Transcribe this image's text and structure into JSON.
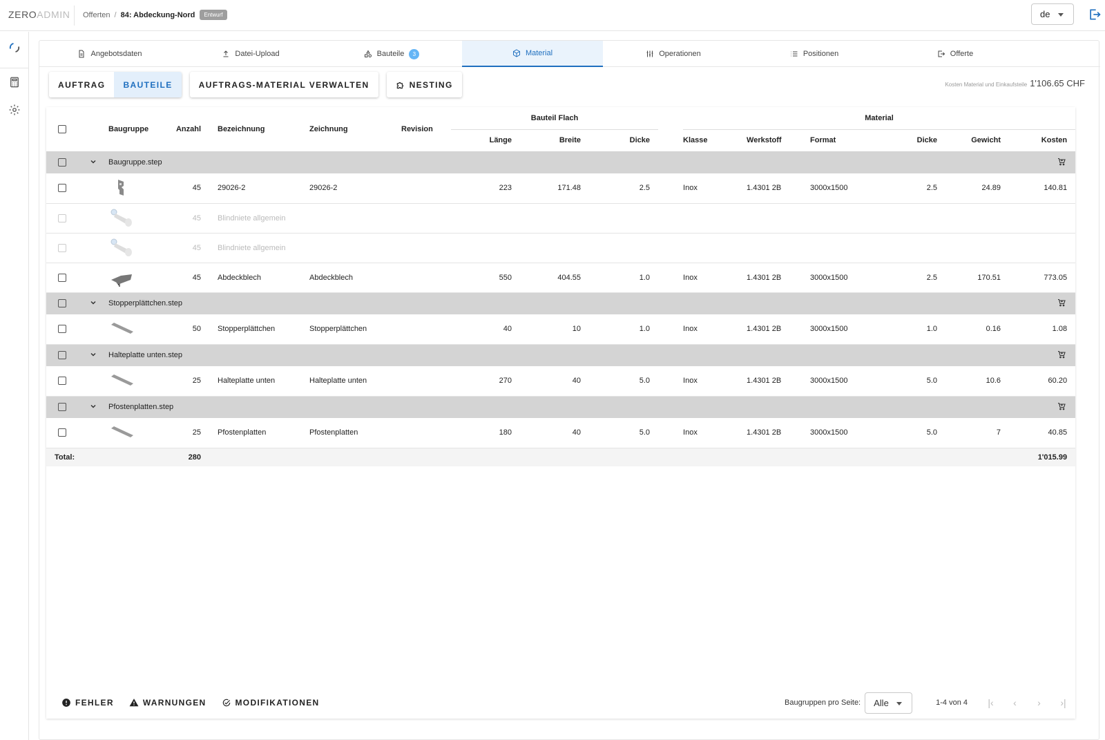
{
  "topbar": {
    "logo_bold": "ZERO",
    "logo_thin": "ADMIN",
    "breadcrumb_parent": "Offerten",
    "breadcrumb_sep": "/",
    "breadcrumb_current": "84: Abdeckung-Nord",
    "status_badge": "Entwurf",
    "language": "de"
  },
  "tabs": [
    {
      "label": "Angebotsdaten",
      "icon": "document-icon"
    },
    {
      "label": "Datei-Upload",
      "icon": "upload-icon"
    },
    {
      "label": "Bauteile",
      "icon": "parts-icon",
      "count": "3"
    },
    {
      "label": "Material",
      "icon": "cube-icon",
      "active": true
    },
    {
      "label": "Operationen",
      "icon": "sliders-icon"
    },
    {
      "label": "Positionen",
      "icon": "list-icon"
    },
    {
      "label": "Offerte",
      "icon": "export-icon"
    }
  ],
  "toolbar": {
    "toggle_auftrag": "AUFTRAG",
    "toggle_bauteile": "BAUTEILE",
    "manage_material": "AUFTRAGS-MATERIAL VERWALTEN",
    "nesting": "NESTING",
    "cost_label": "Kosten Material und Einkaufsteile",
    "cost_value": "1'106.65 CHF"
  },
  "table": {
    "group_headers": {
      "bauteil_flach": "Bauteil Flach",
      "material": "Material"
    },
    "columns": {
      "baugruppe": "Baugruppe",
      "anzahl": "Anzahl",
      "bezeichnung": "Bezeichnung",
      "zeichnung": "Zeichnung",
      "revision": "Revision",
      "laenge": "Länge",
      "breite": "Breite",
      "dicke": "Dicke",
      "klasse": "Klasse",
      "werkstoff": "Werkstoff",
      "format": "Format",
      "mdicke": "Dicke",
      "gewicht": "Gewicht",
      "kosten": "Kosten"
    },
    "groups": [
      {
        "name": "Baugruppe.step",
        "rows": [
          {
            "thumb": "bracket",
            "anzahl": "45",
            "bezeichnung": "29026-2",
            "zeichnung": "29026-2",
            "laenge": "223",
            "breite": "171.48",
            "dicke": "2.5",
            "klasse": "Inox",
            "werkstoff": "1.4301 2B",
            "format": "3000x1500",
            "mdicke": "2.5",
            "gewicht": "24.89",
            "kosten": "140.81"
          },
          {
            "thumb": "rivet",
            "dim": true,
            "anzahl": "45",
            "bezeichnung": "Blindniete allgemein",
            "zeichnung": "",
            "laenge": "",
            "breite": "",
            "dicke": "",
            "klasse": "",
            "werkstoff": "",
            "format": "",
            "mdicke": "",
            "gewicht": "",
            "kosten": ""
          },
          {
            "thumb": "rivet",
            "dim": true,
            "anzahl": "45",
            "bezeichnung": "Blindniete allgemein",
            "zeichnung": "",
            "laenge": "",
            "breite": "",
            "dicke": "",
            "klasse": "",
            "werkstoff": "",
            "format": "",
            "mdicke": "",
            "gewicht": "",
            "kosten": ""
          },
          {
            "thumb": "cover",
            "anzahl": "45",
            "bezeichnung": "Abdeckblech",
            "zeichnung": "Abdeckblech",
            "laenge": "550",
            "breite": "404.55",
            "dicke": "1.0",
            "klasse": "Inox",
            "werkstoff": "1.4301 2B",
            "format": "3000x1500",
            "mdicke": "2.5",
            "gewicht": "170.51",
            "kosten": "773.05"
          }
        ]
      },
      {
        "name": "Stopperplättchen.step",
        "rows": [
          {
            "thumb": "plate",
            "anzahl": "50",
            "bezeichnung": "Stopperplättchen",
            "zeichnung": "Stopperplättchen",
            "laenge": "40",
            "breite": "10",
            "dicke": "1.0",
            "klasse": "Inox",
            "werkstoff": "1.4301 2B",
            "format": "3000x1500",
            "mdicke": "1.0",
            "gewicht": "0.16",
            "kosten": "1.08"
          }
        ]
      },
      {
        "name": "Halteplatte unten.step",
        "rows": [
          {
            "thumb": "plate",
            "anzahl": "25",
            "bezeichnung": "Halteplatte unten",
            "zeichnung": "Halteplatte unten",
            "laenge": "270",
            "breite": "40",
            "dicke": "5.0",
            "klasse": "Inox",
            "werkstoff": "1.4301 2B",
            "format": "3000x1500",
            "mdicke": "5.0",
            "gewicht": "10.6",
            "kosten": "60.20"
          }
        ]
      },
      {
        "name": "Pfostenplatten.step",
        "rows": [
          {
            "thumb": "plate",
            "anzahl": "25",
            "bezeichnung": "Pfostenplatten",
            "zeichnung": "Pfostenplatten",
            "laenge": "180",
            "breite": "40",
            "dicke": "5.0",
            "klasse": "Inox",
            "werkstoff": "1.4301 2B",
            "format": "3000x1500",
            "mdicke": "5.0",
            "gewicht": "7",
            "kosten": "40.85"
          }
        ]
      }
    ],
    "total": {
      "label": "Total:",
      "anzahl": "280",
      "kosten": "1'015.99"
    }
  },
  "footer": {
    "fehler": "FEHLER",
    "warnungen": "WARNUNGEN",
    "modifikationen": "MODIFIKATIONEN",
    "per_page_label": "Baugruppen pro Seite:",
    "per_page_value": "Alle",
    "range": "1-4 von 4"
  },
  "colors": {
    "accent": "#1f6fbf",
    "active_tab_bg": "#eaf3fc",
    "group_row_bg": "#d4d4d4",
    "badge_blue": "#64b5f6"
  }
}
